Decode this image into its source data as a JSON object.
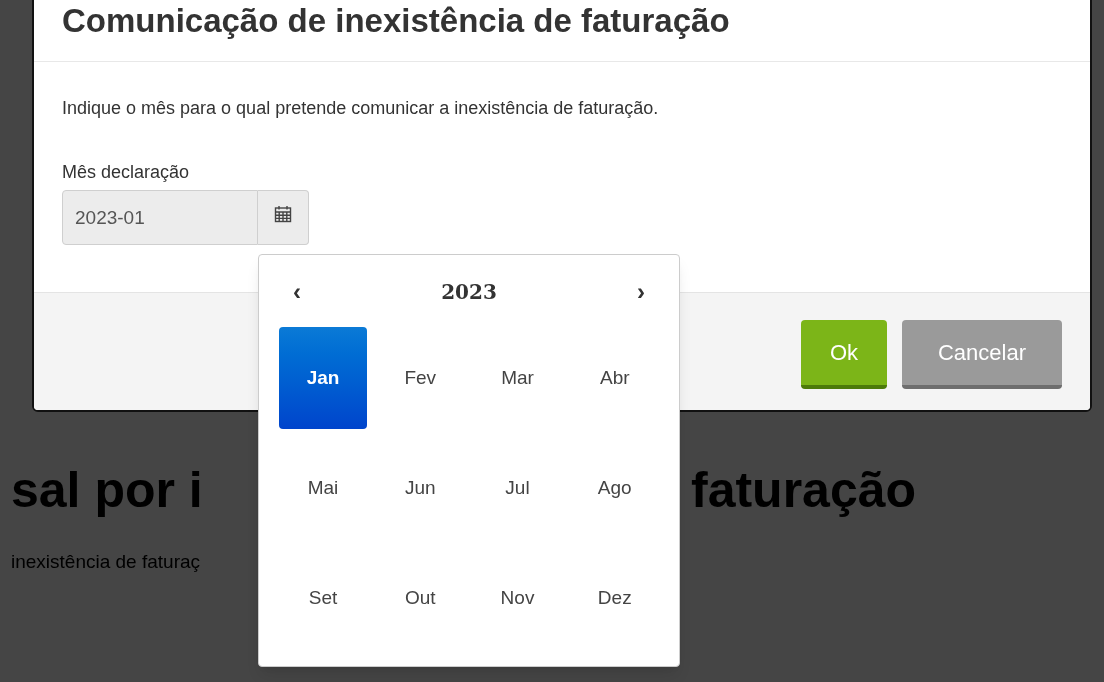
{
  "background": {
    "heading_left": "sal por i",
    "heading_right": "faturação",
    "subtitle": "inexistência de faturaç"
  },
  "dialog": {
    "title": "Comunicação de inexistência de faturação",
    "message": "Indique o mês para o qual pretende comunicar a inexistência de faturação.",
    "field": {
      "label": "Mês declaração",
      "value": "2023-01"
    },
    "buttons": [
      {
        "label": "Ok",
        "kind": "primary"
      },
      {
        "label": "Cancelar",
        "kind": "secondary"
      }
    ]
  },
  "month_picker": {
    "prev": "‹",
    "year": "2023",
    "next": "›",
    "months": [
      {
        "label": "Jan",
        "selected": true
      },
      {
        "label": "Fev",
        "selected": false
      },
      {
        "label": "Mar",
        "selected": false
      },
      {
        "label": "Abr",
        "selected": false
      },
      {
        "label": "Mai",
        "selected": false
      },
      {
        "label": "Jun",
        "selected": false
      },
      {
        "label": "Jul",
        "selected": false
      },
      {
        "label": "Ago",
        "selected": false
      },
      {
        "label": "Set",
        "selected": false
      },
      {
        "label": "Out",
        "selected": false
      },
      {
        "label": "Nov",
        "selected": false
      },
      {
        "label": "Dez",
        "selected": false
      }
    ]
  }
}
